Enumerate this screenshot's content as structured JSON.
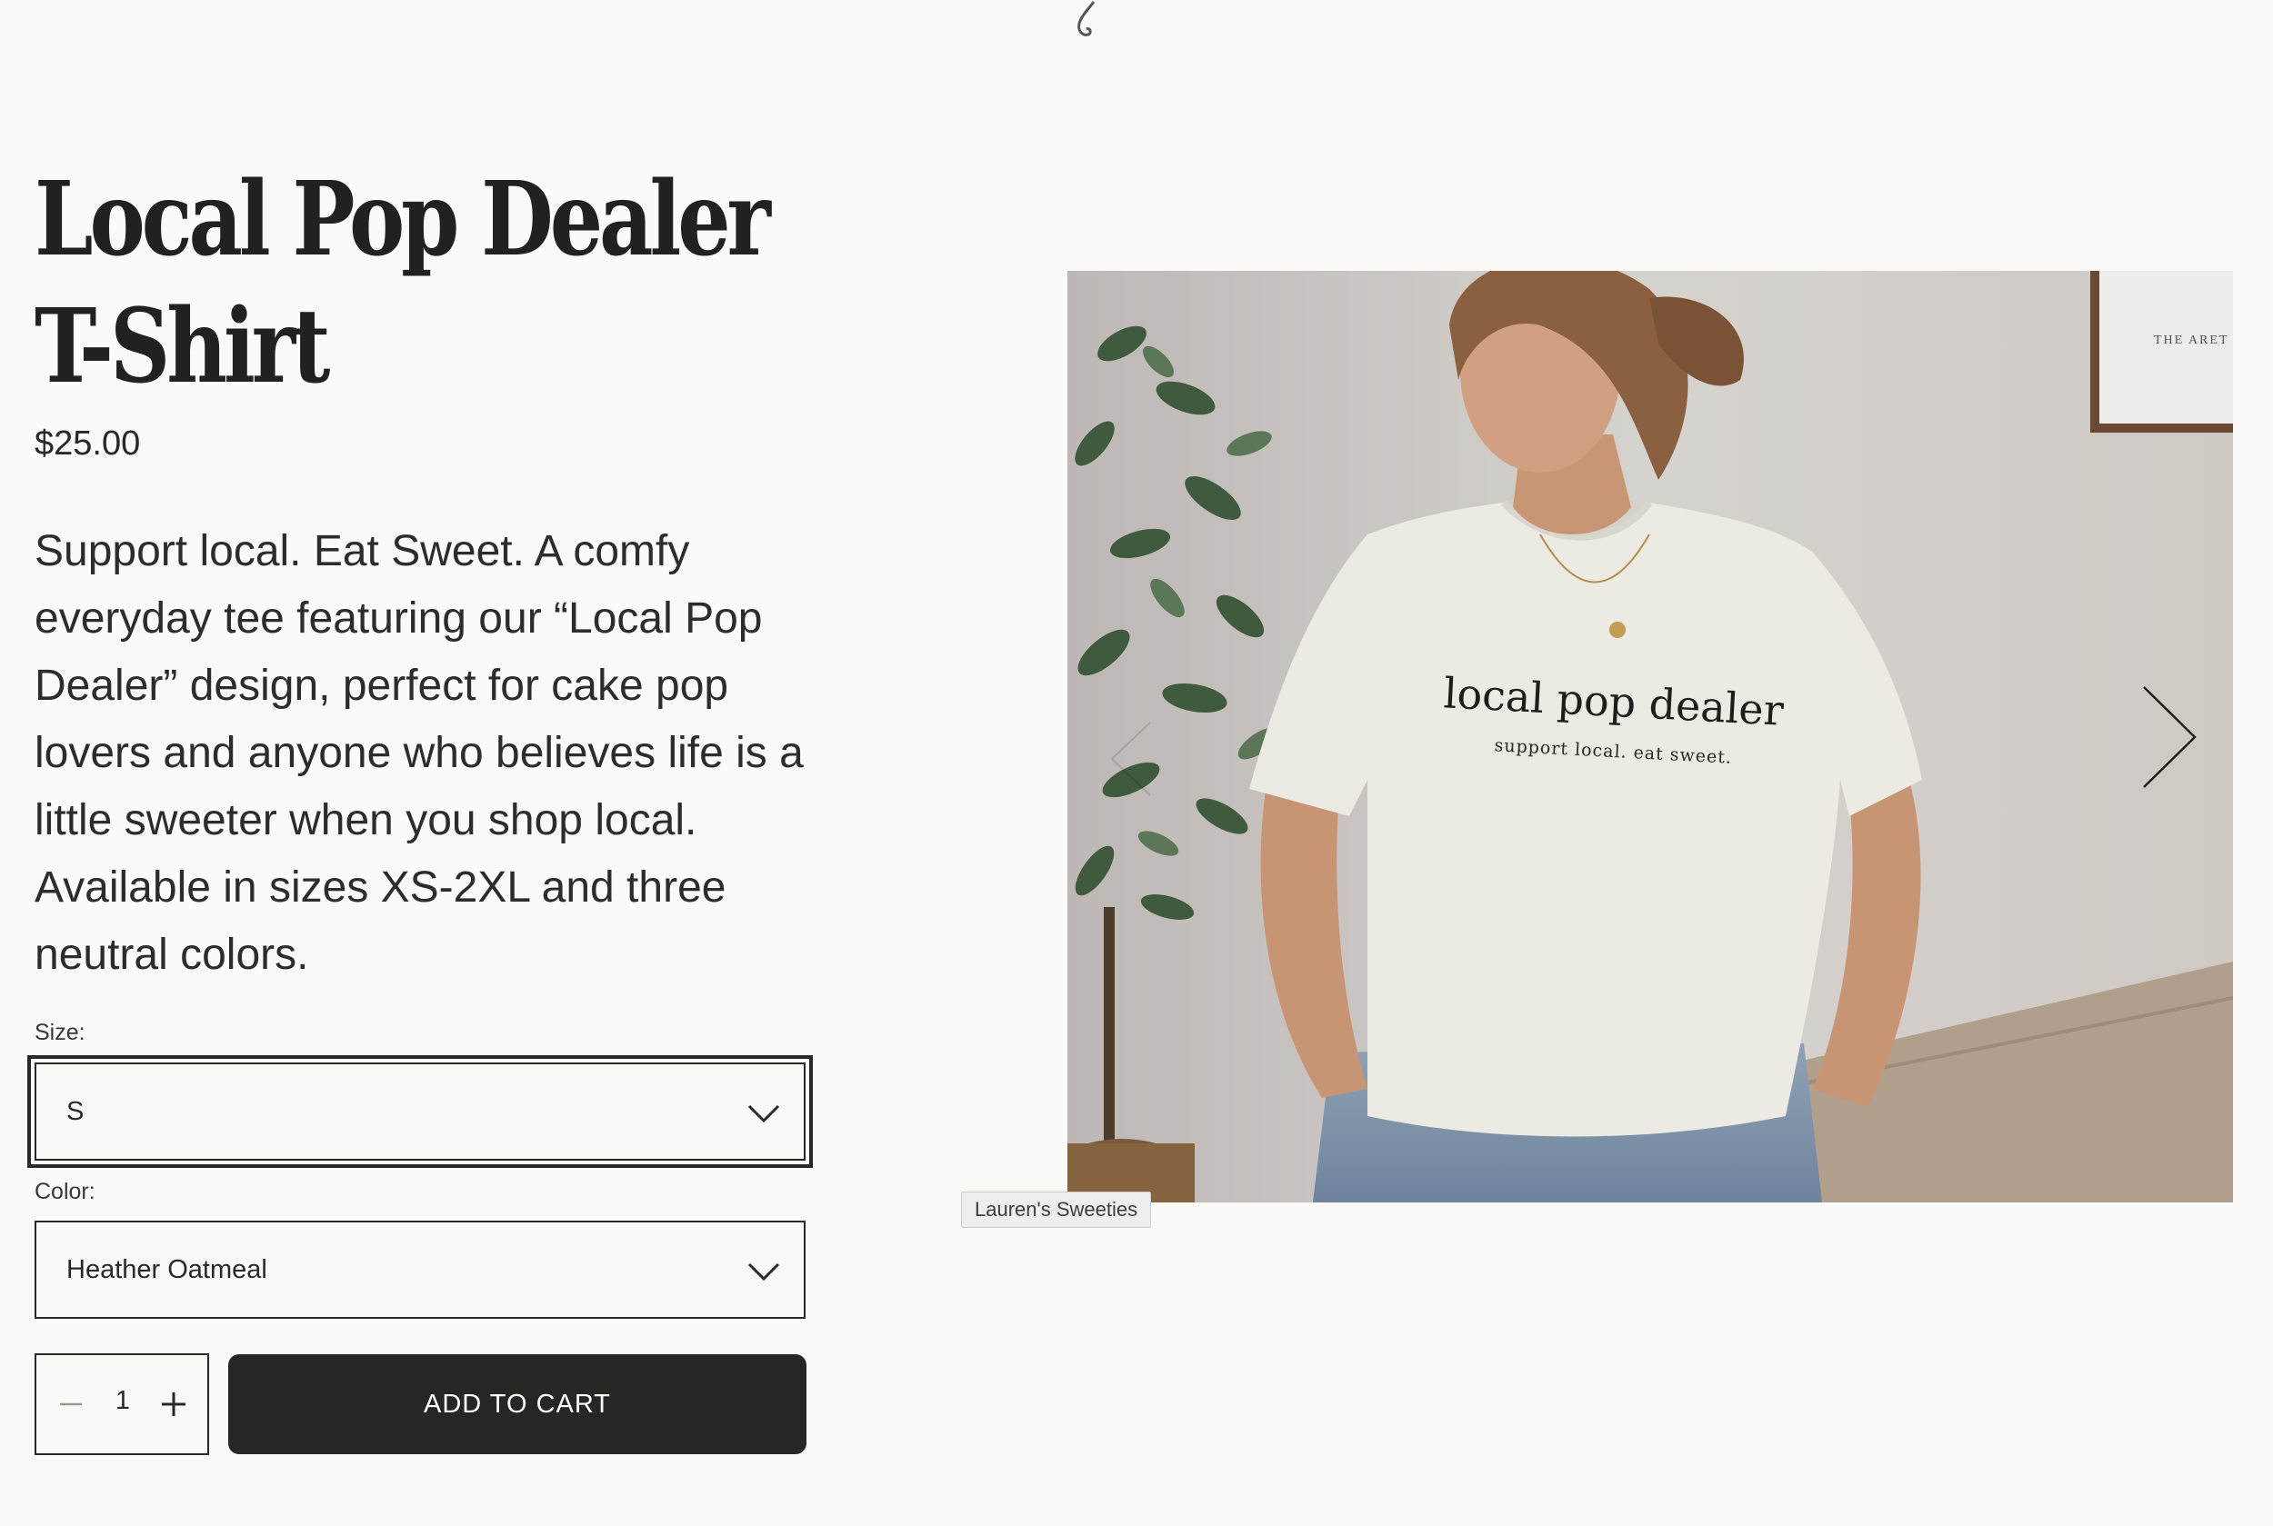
{
  "product": {
    "title": "Local Pop Dealer T-Shirt",
    "price": "$25.00",
    "description": "Support local. Eat Sweet. A comfy everyday tee featuring our “Local Pop Dealer” design, perfect for cake pop lovers and anyone who believes life is a little sweeter when you shop local. Available in sizes XS-2XL and three neutral colors."
  },
  "options": {
    "size_label": "Size:",
    "size_value": "S",
    "color_label": "Color:",
    "color_value": "Heather Oatmeal"
  },
  "cart": {
    "quantity": "1",
    "add_to_cart_label": "ADD TO CART"
  },
  "gallery": {
    "shirt_print_main": "local pop dealer",
    "shirt_print_sub": "support local. eat sweet.",
    "frame_text": "THE ARET",
    "tooltip": "Lauren's Sweeties"
  },
  "icons": {
    "size_dropdown": "chevron-down-icon",
    "color_dropdown": "chevron-down-icon",
    "qty_decrease": "minus-icon",
    "qty_increase": "plus-icon",
    "next": "chevron-right-icon",
    "prev": "chevron-left-icon"
  },
  "colors": {
    "background": "#fbfaf7",
    "text": "#2a2824",
    "button": "#282622"
  }
}
